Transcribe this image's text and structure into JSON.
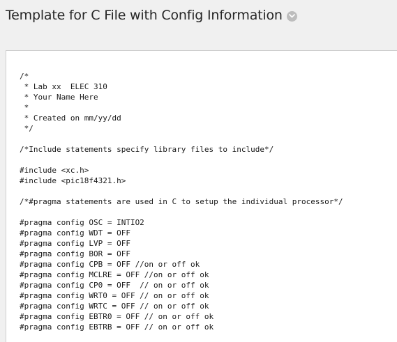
{
  "page": {
    "title": "Template for C File with Config Information",
    "title_menu_icon": "chevron-down-icon"
  },
  "code": {
    "lines": [
      "/*",
      " * Lab xx  ELEC 310",
      " * Your Name Here",
      " *",
      " * Created on mm/yy/dd",
      " */",
      "",
      "/*Include statements specify library files to include*/",
      "",
      "#include <xc.h>",
      "#include <pic18f4321.h>",
      "",
      "/*#pragma statements are used in C to setup the individual processor*/",
      "",
      "#pragma config OSC = INTIO2",
      "#pragma config WDT = OFF",
      "#pragma config LVP = OFF",
      "#pragma config BOR = OFF",
      "#pragma config CPB = OFF //on or off ok",
      "#pragma config MCLRE = OFF //on or off ok",
      "#pragma config CP0 = OFF  // on or off ok",
      "#pragma config WRT0 = OFF // on or off ok",
      "#pragma config WRTC = OFF // on or off ok",
      "#pragma config EBTR0 = OFF // on or off ok",
      "#pragma config EBTRB = OFF // on or off ok"
    ]
  }
}
